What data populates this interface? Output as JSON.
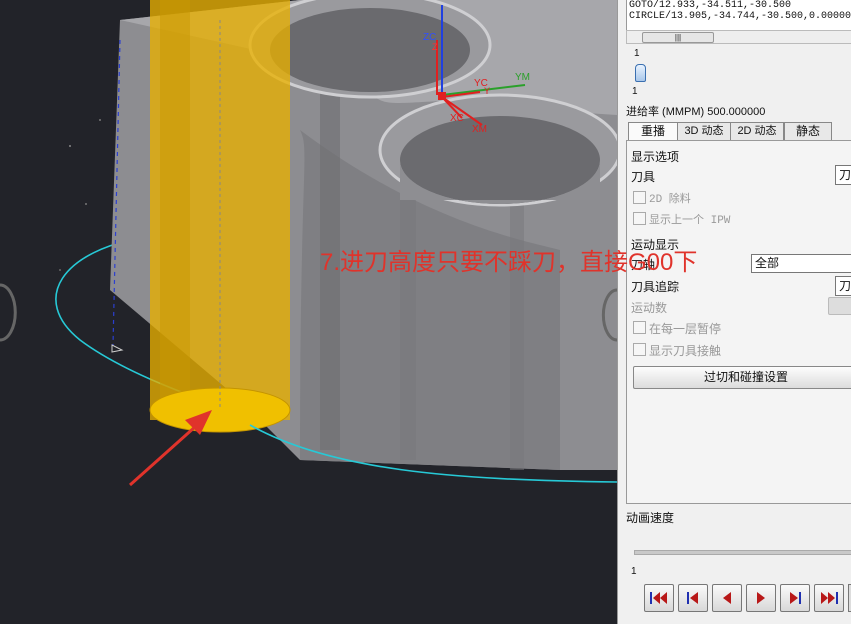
{
  "viewport": {
    "annotation": "7.进刀高度只要不踩刀，直接G00下",
    "axis_labels": {
      "zc": "ZC",
      "z": "Z",
      "yc": "YC",
      "ym": "YM",
      "y": "Y",
      "xc": "XC",
      "xm": "XM"
    },
    "colors": {
      "tool": "#e8b000",
      "annotation": "#e0332b",
      "toolpath": "#27c9d6",
      "part": "#8a8a8e"
    }
  },
  "panel": {
    "path_lines": [
      "GOTO/12.933,-34.511,-30.500",
      "CIRCLE/13.905,-34.744,-30.500,0.00000"
    ],
    "slider_value": "1",
    "feed_rate_label": "进给率 (MMPM) 500.000000",
    "tabs": [
      "重播",
      "3D 动态",
      "2D 动态",
      "静态"
    ],
    "display_options_label": "显示选项",
    "tool_label": "刀具",
    "tool_value": "刀",
    "remove_2d_label": "2D 除料",
    "show_prev_ipw_label": "显示上一个 IPW",
    "motion_display_label": "运动显示",
    "tool_axis_label": "刀轴",
    "tool_axis_value": "全部",
    "tool_trace_label": "刀具追踪",
    "tool_trace_value": "刀",
    "motion_count_label": "运动数",
    "pause_each_layer_label": "在每一层暂停",
    "show_tool_contact_label": "显示刀具接触",
    "gouge_button": "过切和碰撞设置",
    "anim_speed_label": "动画速度",
    "speed_value": "1"
  }
}
